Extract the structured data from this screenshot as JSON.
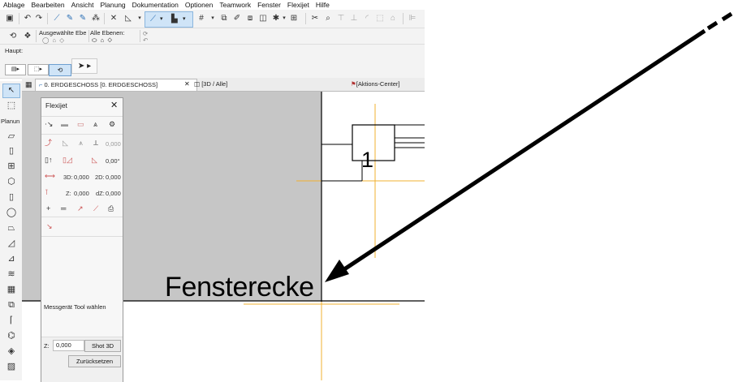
{
  "menu": [
    "Ablage",
    "Bearbeiten",
    "Ansicht",
    "Planung",
    "Dokumentation",
    "Optionen",
    "Teamwork",
    "Fenster",
    "Flexijet",
    "Hilfe"
  ],
  "info_box": {
    "selected_elements_label": "Ausgewählte Ebe",
    "all_layers_label": "Alle Ebenen:",
    "main_label": "Haupt:"
  },
  "toolbox": {
    "section_label": "Planun"
  },
  "tabs": [
    {
      "label": "0. ERDGESCHOSS [0. ERDGESCHOSS]",
      "active": true
    },
    {
      "label": "[3D / Alle]",
      "active": false
    },
    {
      "label": "[Aktions-Center]",
      "active": false
    }
  ],
  "palette": {
    "title": "Flexijet",
    "value_rotation": "0,000",
    "value_angle": "0,00°",
    "label_3d": "3D:",
    "value_3d": "0,000",
    "label_2d": "2D:",
    "value_2d": "0,000",
    "label_z": "Z:",
    "value_z": "0,000",
    "label_dz": "dZ:",
    "value_dz": "0,000",
    "status_text": "Messgerät Tool wählen",
    "z_field_label": "Z:",
    "z_field_value": "0,000",
    "shot_button": "Shot 3D",
    "reset_button": "Zurücksetzen"
  },
  "drawing": {
    "marker_number": "1",
    "annotation": "Fensterecke"
  },
  "colors": {
    "guide_lines": "#f0b030",
    "gray_area": "#c6c6c6",
    "selection_blue": "#cfe4f7"
  }
}
